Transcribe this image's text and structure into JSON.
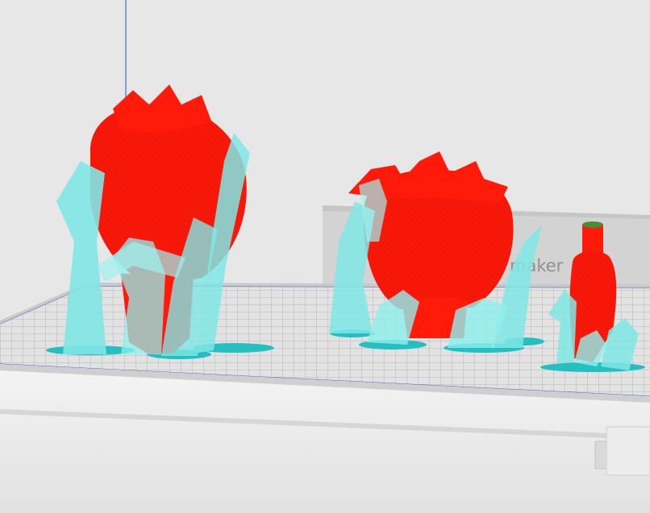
{
  "viewport": {
    "scene": "3d-slicer-preview",
    "background_color": "#e7e7e7",
    "build_plate_color": "#dcdcdc",
    "grid_line_color": "#9a9a9a",
    "plate_outline_color": "#4a6fc7",
    "z_axis_color": "#3d6be0",
    "model_color": "#ff1a0a",
    "support_color": "#7fe7e5",
    "support_base_color": "#24bfc0"
  },
  "printer_frame": {
    "brand_text": "maker",
    "back_wall_color": "#d0d0d0",
    "frame_color": "#f2f2f2"
  },
  "models": [
    {
      "name": "left-figure",
      "color_role": "model_color"
    },
    {
      "name": "center-figure",
      "color_role": "model_color"
    },
    {
      "name": "right-figure",
      "color_role": "model_color"
    }
  ]
}
